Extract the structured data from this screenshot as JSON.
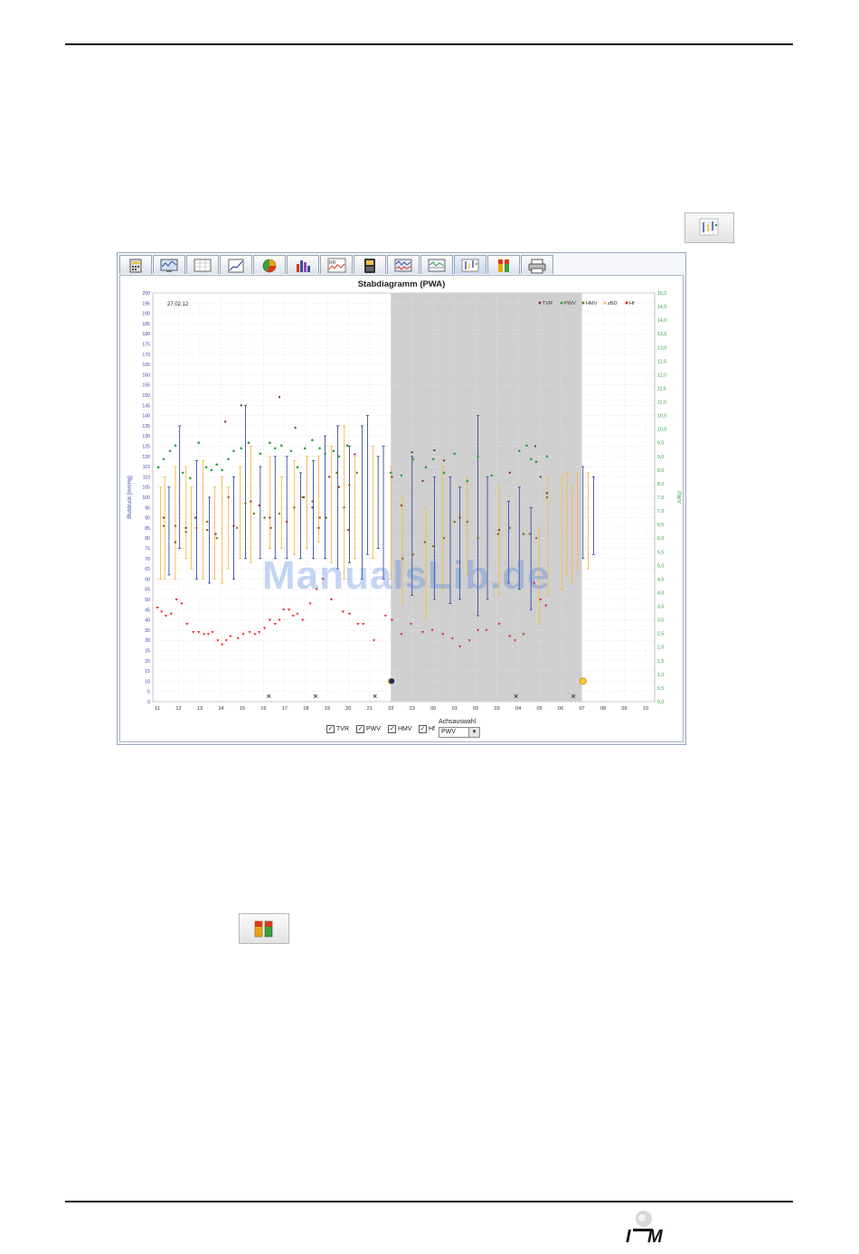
{
  "page": {
    "watermark": "ManualsLib.de",
    "logo_text": "I M"
  },
  "toolbar": {
    "tabs": [
      {
        "icon": "calculator-icon"
      },
      {
        "icon": "monitor-chart-icon"
      },
      {
        "icon": "table-grid-icon"
      },
      {
        "icon": "trend-chart-icon"
      },
      {
        "icon": "pie-chart-icon"
      },
      {
        "icon": "bar-chart-icon"
      },
      {
        "icon": "rr-curve-icon"
      },
      {
        "icon": "device-icon"
      },
      {
        "icon": "wave-chart-icon"
      },
      {
        "icon": "waveform-table-icon"
      },
      {
        "icon": "stab-diagram-icon",
        "active": true
      },
      {
        "icon": "pause-bars-icon"
      },
      {
        "icon": "printer-icon"
      }
    ]
  },
  "colors": {
    "tvr": "#8b3a3a",
    "pwv": "#2e9e3e",
    "hmv": "#8a6a1e",
    "zbd": "#f4b942",
    "hf": "#e02020",
    "blue_bar": "#3c4aa0",
    "night_shade": "#cfcfcf",
    "left_axis": "#3a4bb0",
    "right_axis": "#2e9e3e"
  },
  "chart_data": {
    "type": "bar",
    "title": "Stabdiagramm (PWA)",
    "date_label": "27.02.12",
    "ylabel": "Blutdruck [mmHg]",
    "y2label": "PWV",
    "ylim": [
      0,
      200
    ],
    "y2lim": [
      0,
      15
    ],
    "yticks": [
      "0",
      "5",
      "10",
      "15",
      "20",
      "25",
      "30",
      "35",
      "40",
      "45",
      "50",
      "55",
      "60",
      "65",
      "70",
      "75",
      "80",
      "85",
      "90",
      "95",
      "100",
      "105",
      "110",
      "115",
      "120",
      "125",
      "130",
      "135",
      "140",
      "145",
      "150",
      "155",
      "160",
      "165",
      "170",
      "175",
      "180",
      "185",
      "190",
      "195",
      "200"
    ],
    "y2ticks": [
      "0,0",
      "0,5",
      "1,0",
      "1,5",
      "2,0",
      "2,5",
      "3,0",
      "3,5",
      "4,0",
      "4,5",
      "5,0",
      "5,5",
      "6,0",
      "6,5",
      "7,0",
      "7,5",
      "8,0",
      "8,5",
      "9,0",
      "9,5",
      "10,0",
      "10,5",
      "11,0",
      "11,5",
      "12,0",
      "12,5",
      "13,0",
      "13,5",
      "14,0",
      "14,5",
      "15,0"
    ],
    "xticks": [
      "11",
      "12",
      "13",
      "14",
      "15",
      "16",
      "17",
      "18",
      "19",
      "20",
      "21",
      "22",
      "23",
      "00",
      "01",
      "02",
      "03",
      "04",
      "05",
      "06",
      "07",
      "08",
      "09",
      "10"
    ],
    "night_range": [
      "22",
      "07"
    ],
    "legend": [
      "TVR",
      "PWV",
      "HMV",
      "zBD",
      "Hf"
    ],
    "legend_placement": "top-right",
    "grid": true,
    "bars": [
      {
        "x": 0.15,
        "low": 60,
        "high": 105,
        "c": "y"
      },
      {
        "x": 0.35,
        "low": 60,
        "high": 110,
        "c": "y"
      },
      {
        "x": 0.55,
        "low": 62,
        "high": 105,
        "c": "b"
      },
      {
        "x": 0.85,
        "low": 60,
        "high": 115,
        "c": "y"
      },
      {
        "x": 1.05,
        "low": 75,
        "high": 135,
        "c": "b"
      },
      {
        "x": 1.35,
        "low": 70,
        "high": 115,
        "c": "y"
      },
      {
        "x": 1.6,
        "low": 65,
        "high": 105,
        "c": "y"
      },
      {
        "x": 1.85,
        "low": 60,
        "high": 118,
        "c": "b"
      },
      {
        "x": 2.15,
        "low": 60,
        "high": 118,
        "c": "y"
      },
      {
        "x": 2.45,
        "low": 58,
        "high": 100,
        "c": "b"
      },
      {
        "x": 2.7,
        "low": 60,
        "high": 105,
        "c": "y"
      },
      {
        "x": 3.05,
        "low": 58,
        "high": 110,
        "c": "y"
      },
      {
        "x": 3.35,
        "low": 65,
        "high": 105,
        "c": "y"
      },
      {
        "x": 3.6,
        "low": 60,
        "high": 110,
        "c": "b"
      },
      {
        "x": 3.9,
        "low": 70,
        "high": 115,
        "c": "y"
      },
      {
        "x": 4.15,
        "low": 70,
        "high": 145,
        "c": "b"
      },
      {
        "x": 4.4,
        "low": 68,
        "high": 125,
        "c": "y"
      },
      {
        "x": 4.85,
        "low": 70,
        "high": 115,
        "c": "b"
      },
      {
        "x": 5.3,
        "low": 75,
        "high": 120,
        "c": "y"
      },
      {
        "x": 5.55,
        "low": 70,
        "high": 120,
        "c": "b"
      },
      {
        "x": 5.85,
        "low": 75,
        "high": 110,
        "c": "y"
      },
      {
        "x": 6.1,
        "low": 70,
        "high": 120,
        "c": "b"
      },
      {
        "x": 6.45,
        "low": 72,
        "high": 118,
        "c": "y"
      },
      {
        "x": 6.75,
        "low": 70,
        "high": 112,
        "c": "b"
      },
      {
        "x": 7.05,
        "low": 75,
        "high": 120,
        "c": "y"
      },
      {
        "x": 7.35,
        "low": 70,
        "high": 118,
        "c": "b"
      },
      {
        "x": 7.6,
        "low": 78,
        "high": 120,
        "c": "y"
      },
      {
        "x": 7.9,
        "low": 70,
        "high": 130,
        "c": "b"
      },
      {
        "x": 8.2,
        "low": 68,
        "high": 125,
        "c": "y"
      },
      {
        "x": 8.5,
        "low": 65,
        "high": 135,
        "c": "b"
      },
      {
        "x": 8.8,
        "low": 60,
        "high": 135,
        "c": "y"
      },
      {
        "x": 9.05,
        "low": 68,
        "high": 125,
        "c": "b"
      },
      {
        "x": 9.3,
        "low": 70,
        "high": 120,
        "c": "y"
      },
      {
        "x": 9.65,
        "low": 60,
        "high": 135,
        "c": "b"
      },
      {
        "x": 9.9,
        "low": 72,
        "high": 140,
        "c": "b"
      },
      {
        "x": 10.15,
        "low": 70,
        "high": 125,
        "c": "y"
      },
      {
        "x": 10.4,
        "low": 75,
        "high": 120,
        "c": "b"
      },
      {
        "x": 10.65,
        "low": 60,
        "high": 125,
        "c": "b"
      },
      {
        "x": 11.0,
        "low": 60,
        "high": 115,
        "c": "y"
      },
      {
        "x": 11.55,
        "low": 48,
        "high": 100,
        "c": "y"
      },
      {
        "x": 12.0,
        "low": 52,
        "high": 120,
        "c": "b"
      },
      {
        "x": 12.65,
        "low": 40,
        "high": 95,
        "c": "y"
      },
      {
        "x": 13.05,
        "low": 50,
        "high": 110,
        "c": "b"
      },
      {
        "x": 13.45,
        "low": 55,
        "high": 115,
        "c": "y"
      },
      {
        "x": 13.8,
        "low": 48,
        "high": 110,
        "c": "b"
      },
      {
        "x": 14.25,
        "low": 50,
        "high": 105,
        "c": "b"
      },
      {
        "x": 14.6,
        "low": 62,
        "high": 110,
        "c": "y"
      },
      {
        "x": 15.1,
        "low": 42,
        "high": 140,
        "c": "b"
      },
      {
        "x": 15.55,
        "low": 50,
        "high": 110,
        "c": "b"
      },
      {
        "x": 16.1,
        "low": 52,
        "high": 105,
        "c": "y"
      },
      {
        "x": 16.55,
        "low": 58,
        "high": 98,
        "c": "b"
      },
      {
        "x": 17.05,
        "low": 55,
        "high": 105,
        "c": "b"
      },
      {
        "x": 17.6,
        "low": 45,
        "high": 95,
        "c": "b"
      },
      {
        "x": 18.0,
        "low": 38,
        "high": 85,
        "c": "y"
      },
      {
        "x": 18.4,
        "low": 52,
        "high": 110,
        "c": "y"
      },
      {
        "x": 19.05,
        "low": 55,
        "high": 110,
        "c": "y"
      },
      {
        "x": 19.3,
        "low": 62,
        "high": 112,
        "c": "y"
      },
      {
        "x": 19.55,
        "low": 58,
        "high": 105,
        "c": "y"
      },
      {
        "x": 19.8,
        "low": 65,
        "high": 112,
        "c": "y"
      },
      {
        "x": 20.05,
        "low": 70,
        "high": 115,
        "c": "b"
      },
      {
        "x": 20.3,
        "low": 65,
        "high": 112,
        "c": "y"
      },
      {
        "x": 20.55,
        "low": 72,
        "high": 110,
        "c": "b"
      }
    ],
    "hf_points": [
      [
        0.0,
        46
      ],
      [
        0.2,
        44
      ],
      [
        0.4,
        42
      ],
      [
        0.65,
        43
      ],
      [
        0.9,
        50
      ],
      [
        1.15,
        48
      ],
      [
        1.4,
        38
      ],
      [
        1.7,
        34
      ],
      [
        1.95,
        34
      ],
      [
        2.2,
        33
      ],
      [
        2.4,
        33
      ],
      [
        2.6,
        34
      ],
      [
        2.85,
        30
      ],
      [
        3.05,
        28
      ],
      [
        3.25,
        30
      ],
      [
        3.45,
        32
      ],
      [
        3.8,
        31
      ],
      [
        4.05,
        33
      ],
      [
        4.35,
        34
      ],
      [
        4.6,
        33
      ],
      [
        4.8,
        34
      ],
      [
        5.05,
        36
      ],
      [
        5.3,
        40
      ],
      [
        5.55,
        38
      ],
      [
        5.75,
        40
      ],
      [
        5.95,
        45
      ],
      [
        6.2,
        45
      ],
      [
        6.4,
        42
      ],
      [
        6.6,
        43
      ],
      [
        6.85,
        40
      ],
      [
        7.2,
        48
      ],
      [
        7.5,
        55
      ],
      [
        7.8,
        60
      ],
      [
        8.2,
        50
      ],
      [
        8.75,
        44
      ],
      [
        9.05,
        43
      ],
      [
        9.45,
        38
      ],
      [
        9.7,
        38
      ],
      [
        10.2,
        30
      ],
      [
        10.75,
        42
      ],
      [
        11.05,
        40
      ],
      [
        11.5,
        33
      ],
      [
        11.95,
        38
      ],
      [
        12.5,
        34
      ],
      [
        12.95,
        35
      ],
      [
        13.45,
        33
      ],
      [
        13.9,
        31
      ],
      [
        14.25,
        27
      ],
      [
        14.7,
        30
      ],
      [
        15.1,
        35
      ],
      [
        15.5,
        35
      ],
      [
        16.1,
        38
      ],
      [
        16.6,
        32
      ],
      [
        16.85,
        30
      ],
      [
        17.25,
        33
      ],
      [
        17.75,
        58
      ],
      [
        18.05,
        50
      ],
      [
        18.3,
        47
      ]
    ],
    "pwv_points": [
      [
        0.05,
        8.6
      ],
      [
        0.3,
        8.9
      ],
      [
        0.6,
        9.2
      ],
      [
        0.85,
        9.4
      ],
      [
        1.2,
        8.4
      ],
      [
        1.55,
        8.2
      ],
      [
        1.95,
        9.5
      ],
      [
        2.3,
        8.6
      ],
      [
        2.55,
        8.5
      ],
      [
        2.8,
        8.7
      ],
      [
        3.05,
        8.5
      ],
      [
        3.35,
        8.9
      ],
      [
        3.6,
        9.2
      ],
      [
        3.95,
        9.3
      ],
      [
        4.3,
        9.5
      ],
      [
        4.85,
        9.1
      ],
      [
        5.3,
        9.5
      ],
      [
        5.55,
        9.3
      ],
      [
        5.85,
        9.4
      ],
      [
        6.3,
        9.2
      ],
      [
        6.6,
        8.6
      ],
      [
        6.95,
        9.3
      ],
      [
        7.3,
        9.6
      ],
      [
        7.65,
        9.3
      ],
      [
        7.9,
        9.1
      ],
      [
        8.3,
        9.2
      ],
      [
        8.55,
        9.0
      ],
      [
        8.95,
        9.4
      ],
      [
        11.0,
        8.4
      ],
      [
        11.5,
        8.3
      ],
      [
        12.05,
        8.9
      ],
      [
        12.65,
        8.6
      ],
      [
        13.0,
        8.9
      ],
      [
        13.5,
        8.4
      ],
      [
        14.0,
        9.1
      ],
      [
        14.6,
        8.1
      ],
      [
        15.1,
        9.0
      ],
      [
        15.75,
        8.3
      ],
      [
        17.05,
        9.2
      ],
      [
        17.4,
        9.4
      ],
      [
        17.6,
        8.9
      ],
      [
        17.85,
        8.8
      ],
      [
        18.35,
        9.0
      ]
    ],
    "tvr_points": [
      [
        0.3,
        90
      ],
      [
        0.85,
        78
      ],
      [
        1.35,
        85
      ],
      [
        1.8,
        90
      ],
      [
        2.35,
        84
      ],
      [
        2.75,
        82
      ],
      [
        3.2,
        137
      ],
      [
        3.6,
        86
      ],
      [
        3.95,
        145
      ],
      [
        4.4,
        98
      ],
      [
        4.8,
        96
      ],
      [
        5.3,
        90
      ],
      [
        5.75,
        149
      ],
      [
        6.1,
        88
      ],
      [
        6.5,
        134
      ],
      [
        6.9,
        100
      ],
      [
        7.3,
        95
      ],
      [
        7.6,
        85
      ],
      [
        8.1,
        110
      ],
      [
        8.55,
        105
      ],
      [
        9.0,
        84
      ],
      [
        9.3,
        121
      ],
      [
        11.05,
        110
      ],
      [
        11.5,
        96
      ],
      [
        12.0,
        122
      ],
      [
        12.5,
        108
      ],
      [
        13.05,
        123
      ],
      [
        13.5,
        118
      ],
      [
        14.25,
        90
      ],
      [
        15.1,
        80
      ],
      [
        16.1,
        84
      ],
      [
        16.6,
        112
      ],
      [
        17.25,
        82
      ],
      [
        17.8,
        125
      ],
      [
        18.05,
        110
      ],
      [
        18.35,
        102
      ]
    ],
    "hmv_points": [
      [
        0.3,
        86
      ],
      [
        0.85,
        86
      ],
      [
        1.35,
        83
      ],
      [
        1.85,
        85
      ],
      [
        2.35,
        88
      ],
      [
        2.8,
        80
      ],
      [
        3.35,
        100
      ],
      [
        3.75,
        85
      ],
      [
        4.15,
        97
      ],
      [
        4.55,
        92
      ],
      [
        5.05,
        90
      ],
      [
        5.35,
        85
      ],
      [
        5.75,
        92
      ],
      [
        6.45,
        95
      ],
      [
        6.85,
        100
      ],
      [
        7.3,
        98
      ],
      [
        7.65,
        90
      ],
      [
        7.95,
        90
      ],
      [
        8.45,
        112
      ],
      [
        8.8,
        95
      ],
      [
        9.05,
        106
      ],
      [
        9.4,
        112
      ],
      [
        11.55,
        70
      ],
      [
        12.05,
        72
      ],
      [
        12.6,
        78
      ],
      [
        13.0,
        76
      ],
      [
        13.5,
        80
      ],
      [
        14.0,
        88
      ],
      [
        14.6,
        88
      ],
      [
        15.1,
        80
      ],
      [
        16.05,
        82
      ],
      [
        16.6,
        85
      ],
      [
        17.25,
        82
      ],
      [
        17.55,
        82
      ],
      [
        17.85,
        80
      ],
      [
        18.35,
        100
      ]
    ],
    "x_markers": [
      5.25,
      7.45,
      10.25,
      16.9,
      19.6
    ],
    "moon_x": 11.0,
    "sun_x": 20.05,
    "controls": {
      "tvr": "TVR",
      "pwv": "PWV",
      "hmv": "HMV",
      "hf": "Hf",
      "axis_label": "Achsauswahl",
      "axis_value": "PWV"
    }
  }
}
